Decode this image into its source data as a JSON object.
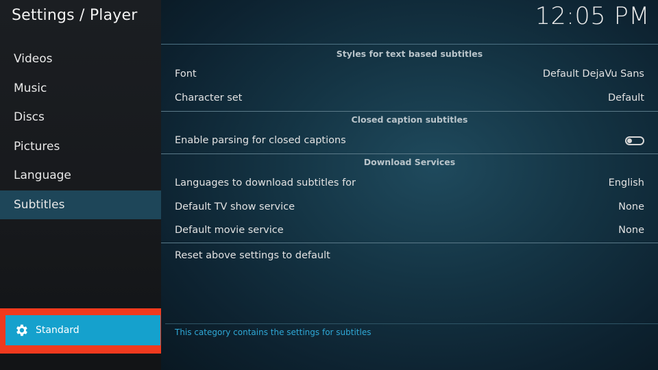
{
  "header": {
    "title": "Settings / Player",
    "clock": "12:05 PM"
  },
  "sidebar": {
    "items": [
      {
        "label": "Videos"
      },
      {
        "label": "Music"
      },
      {
        "label": "Discs"
      },
      {
        "label": "Pictures"
      },
      {
        "label": "Language"
      },
      {
        "label": "Subtitles",
        "active": true
      }
    ],
    "level_button": {
      "label": "Standard",
      "icon": "gear-icon"
    }
  },
  "main": {
    "sections": [
      {
        "header": "Styles for text based subtitles",
        "rows": [
          {
            "label": "Font",
            "value": "Default DejaVu Sans"
          },
          {
            "label": "Character set",
            "value": "Default"
          }
        ]
      },
      {
        "header": "Closed caption subtitles",
        "rows": [
          {
            "label": "Enable parsing for closed captions",
            "value": "",
            "toggle": "off"
          }
        ]
      },
      {
        "header": "Download Services",
        "rows": [
          {
            "label": "Languages to download subtitles for",
            "value": "English"
          },
          {
            "label": "Default TV show service",
            "value": "None"
          },
          {
            "label": "Default movie service",
            "value": "None"
          }
        ]
      }
    ],
    "reset_label": "Reset above settings to default",
    "description": "This category contains the settings for subtitles"
  },
  "colors": {
    "accent": "#15a1cd",
    "highlight_outline": "#f03a1e",
    "active_nav": "#1e4659",
    "description_text": "#2fa8d6"
  }
}
